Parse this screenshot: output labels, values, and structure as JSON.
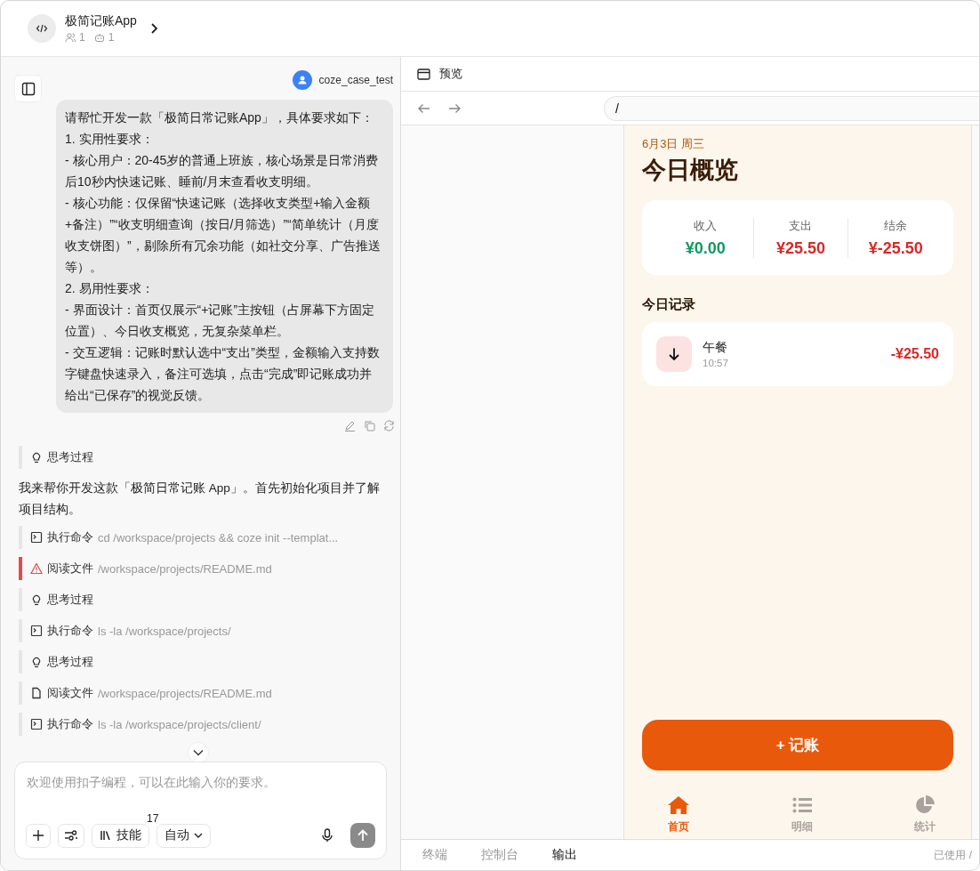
{
  "header": {
    "title": "极简记账App",
    "members": "1",
    "bots": "1"
  },
  "chat": {
    "user": "coze_case_test",
    "message": [
      "请帮忙开发一款「极简日常记账App」，具体要求如下：",
      "1. 实用性要求：",
      "- 核心用户：20-45岁的普通上班族，核心场景是日常消费后10秒内快速记账、睡前/月末查看收支明细。",
      "- 核心功能：仅保留“快速记账（选择收支类型+输入金额+备注）”“收支明细查询（按日/月筛选）”“简单统计（月度收支饼图）”，剔除所有冗余功能（如社交分享、广告推送等）。",
      "2. 易用性要求：",
      "- 界面设计：首页仅展示“+记账”主按钮（占屏幕下方固定位置）、今日收支概览，无复杂菜单栏。",
      "- 交互逻辑：记账时默认选中“支出”类型，金额输入支持数字键盘快速录入，备注可选填，点击“完成”即记账成功并给出“已保存”的视觉反馈。"
    ],
    "log": [
      {
        "kind": "thought",
        "label": "思考过程"
      },
      {
        "kind": "text",
        "label": "我来帮你开发这款「极简日常记账 App」。首先初始化项目并了解项目结构。"
      },
      {
        "kind": "command",
        "label": "执行命令",
        "detail": "cd /workspace/projects && coze init --templat..."
      },
      {
        "kind": "warning",
        "label": "阅读文件",
        "detail": "/workspace/projects/README.md"
      },
      {
        "kind": "thought",
        "label": "思考过程"
      },
      {
        "kind": "command",
        "label": "执行命令",
        "detail": "ls -la /workspace/projects/"
      },
      {
        "kind": "thought",
        "label": "思考过程"
      },
      {
        "kind": "read",
        "label": "阅读文件",
        "detail": "/workspace/projects/README.md"
      },
      {
        "kind": "command",
        "label": "执行命令",
        "detail": "ls -la /workspace/projects/client/"
      }
    ]
  },
  "composer": {
    "placeholder": "欢迎使用扣子编程，可以在此输入你的要求。",
    "skills": "技能",
    "skills_count": "17",
    "mode": "自动"
  },
  "preview": {
    "tab": "预览",
    "url": "/"
  },
  "app": {
    "date": "6月3日 周三",
    "title": "今日概览",
    "summary": [
      {
        "label": "收入",
        "value": "¥0.00",
        "color": "#0f9960"
      },
      {
        "label": "支出",
        "value": "¥25.50",
        "color": "#dc2626"
      },
      {
        "label": "结余",
        "value": "¥-25.50",
        "color": "#dc2626"
      }
    ],
    "records_title": "今日记录",
    "records": [
      {
        "name": "午餐",
        "time": "10:57",
        "amount": "-¥25.50",
        "kind": "expense"
      }
    ],
    "add_button": "+ 记账",
    "nav": [
      {
        "label": "首页",
        "kind": "home",
        "selected": true
      },
      {
        "label": "明细",
        "kind": "list",
        "selected": false
      },
      {
        "label": "统计",
        "kind": "pie",
        "selected": false
      }
    ]
  },
  "bottom_tabs": [
    {
      "label": "终端",
      "selected": false
    },
    {
      "label": "控制台",
      "selected": false
    },
    {
      "label": "输出",
      "selected": true
    }
  ],
  "usage": "已使用 /"
}
